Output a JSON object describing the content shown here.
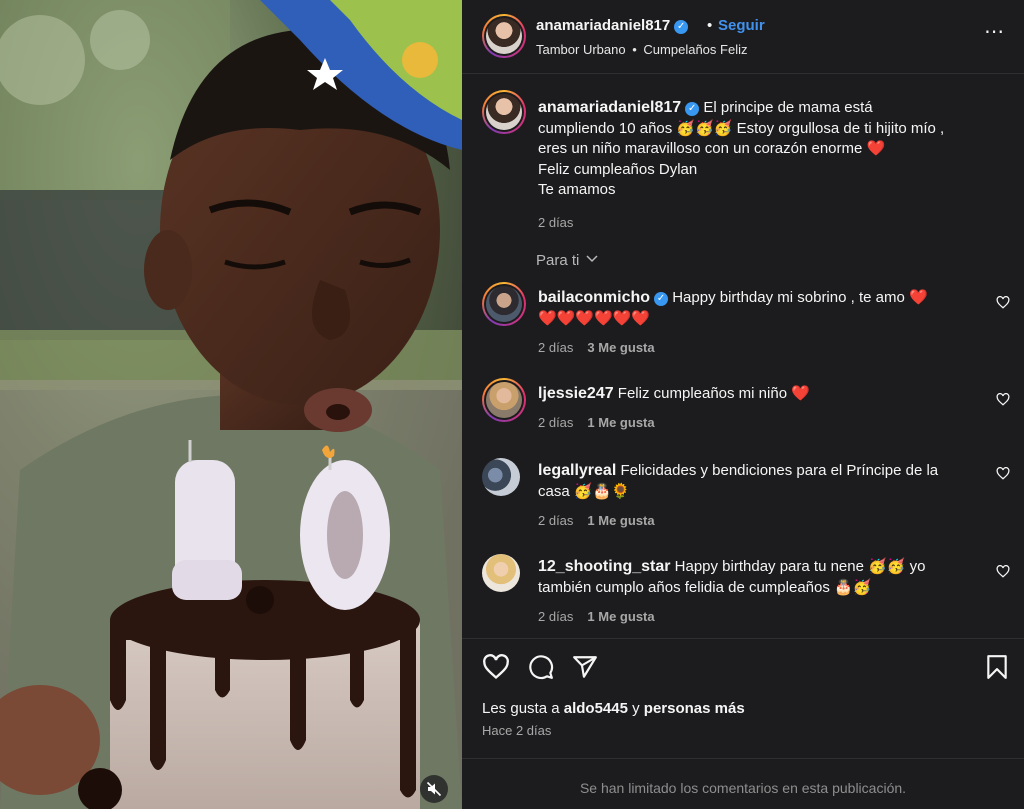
{
  "post": {
    "username": "anamariadaniel817",
    "verified": true,
    "dot": "•",
    "follow_label": "Seguir",
    "audio": "Tambor Urbano",
    "audio_sep": "•",
    "song": "Cumpelaños Feliz",
    "more_icon": "more-horizontal-icon",
    "caption": {
      "line1": "El principe de mama está",
      "line2": "cumpliendo 10 años 🥳🥳🥳 Estoy orgullosa de ti hijito mío ,",
      "line3": "eres un niño maravilloso con un corazón enorme ❤️",
      "line4": "Feliz cumpleaños Dylan",
      "line5": "Te amamos",
      "time": "2 días"
    },
    "for_you": "Para ti"
  },
  "comments": [
    {
      "username": "bailaconmicho",
      "verified": true,
      "text_line1": "Happy birthday mi sobrino , te amo ❤️",
      "text_line2": "❤️❤️❤️❤️❤️❤️",
      "time": "2 días",
      "likes": "3 Me gusta"
    },
    {
      "username": "ljessie247",
      "verified": false,
      "text_line1": "Feliz cumpleaños mi niño ❤️",
      "time": "2 días",
      "likes": "1 Me gusta"
    },
    {
      "username": "legallyreal",
      "verified": false,
      "text_line1": "Felicidades y bendiciones para el Príncipe de la",
      "text_line2": "casa 🥳🎂🌻",
      "time": "2 días",
      "likes": "1 Me gusta"
    },
    {
      "username": "12_shooting_star",
      "verified": false,
      "text_line1": "Happy birthday para tu nene 🥳🥳 yo",
      "text_line2": "también cumplo años felidia de cumpleaños 🎂🥳",
      "time": "2 días",
      "likes": "1 Me gusta"
    }
  ],
  "footer": {
    "likes_prefix": "Les gusta a",
    "likes_user": "aldo5445",
    "likes_mid": "y",
    "likes_rest": "personas más",
    "time_ago": "Hace 2 días",
    "limited": "Se han limitado los comentarios en esta publicación."
  },
  "media": {
    "candle_digits": "10",
    "mute_icon": "muted-speaker-icon"
  },
  "colors": {
    "panel_bg": "#1c1c1e",
    "follow_blue": "#4192ef",
    "verified_blue": "#3897f0",
    "muted_text": "#a8a8a8"
  }
}
